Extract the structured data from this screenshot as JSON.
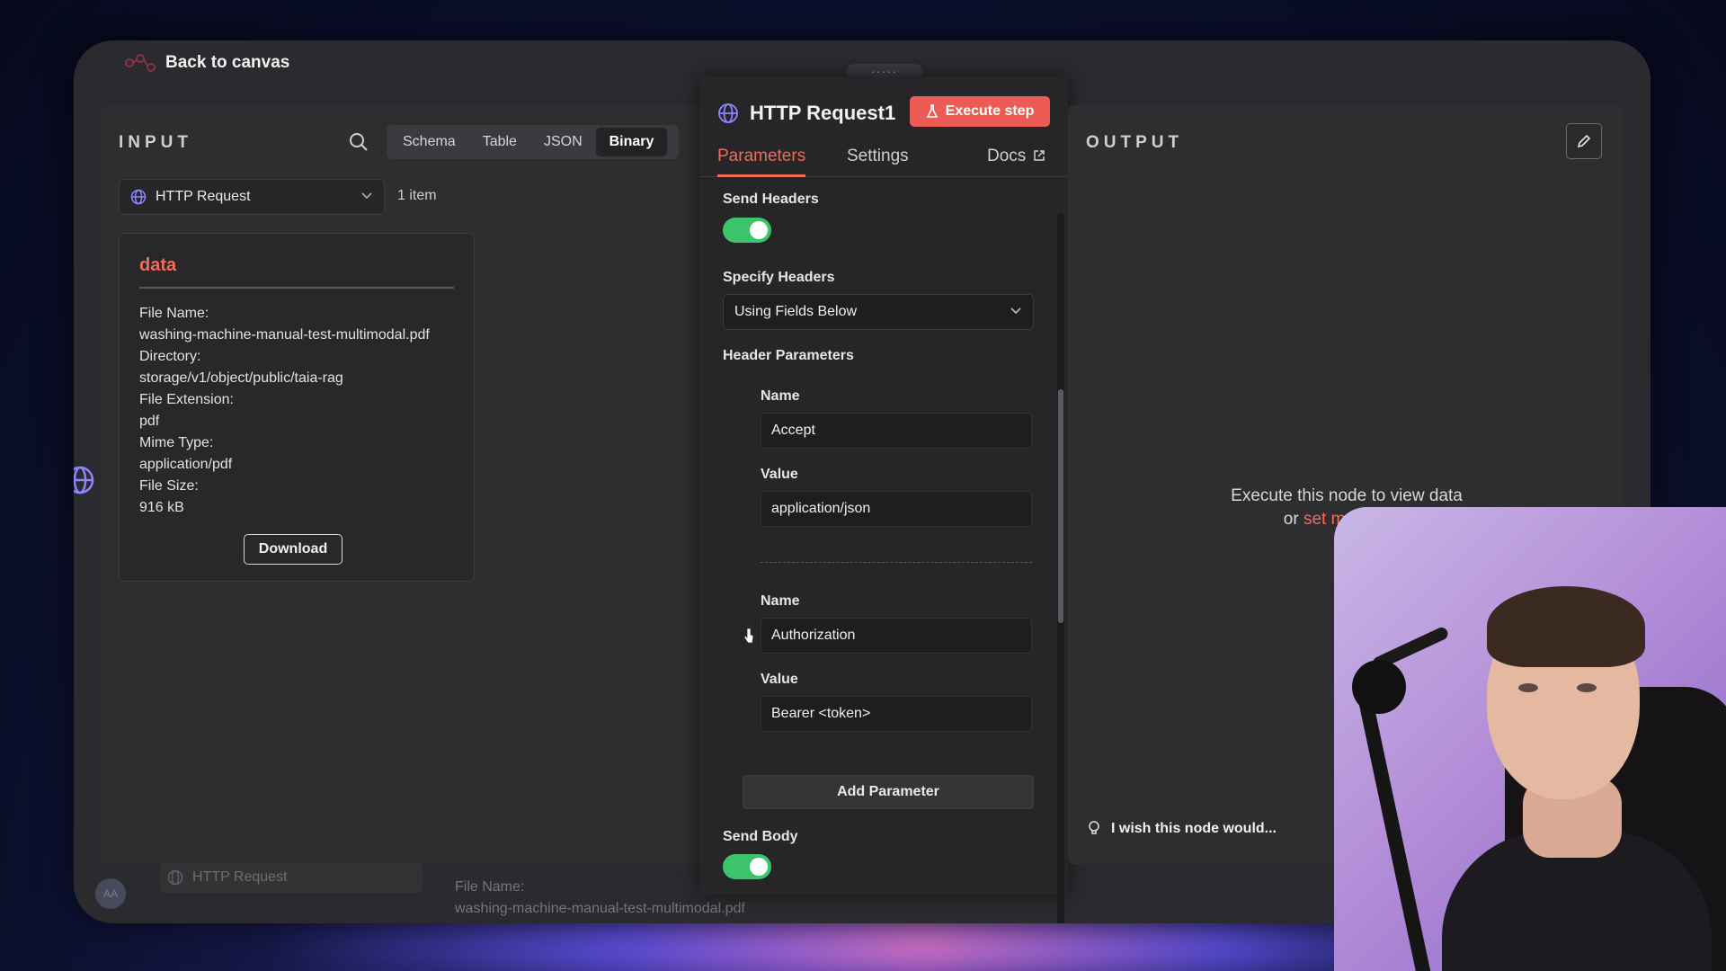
{
  "header": {
    "back_label": "Back to canvas",
    "drag_handle": ":::::"
  },
  "input": {
    "label": "INPUT",
    "view_tabs": [
      "Schema",
      "Table",
      "JSON",
      "Binary"
    ],
    "active_view": "Binary",
    "node_select": "HTTP Request",
    "item_count": "1 item",
    "data_card": {
      "title": "data",
      "file_name_label": "File Name:",
      "file_name": "washing-machine-manual-test-multimodal.pdf",
      "directory_label": "Directory:",
      "directory": "storage/v1/object/public/taia-rag",
      "extension_label": "File Extension:",
      "extension": "pdf",
      "mime_label": "Mime Type:",
      "mime": "application/pdf",
      "size_label": "File Size:",
      "size": "916 kB",
      "download_label": "Download"
    },
    "bottom_node": "HTTP Request",
    "bottom_file_label": "File Name:",
    "bottom_file_name": "washing-machine-manual-test-multimodal.pdf",
    "avatar_initials": "AA"
  },
  "params": {
    "title": "HTTP Request1",
    "execute_label": "Execute step",
    "tabs": [
      "Parameters",
      "Settings",
      "Docs"
    ],
    "active_tab": "Parameters",
    "send_headers_label": "Send Headers",
    "send_headers": true,
    "specify_headers_label": "Specify Headers",
    "specify_headers_value": "Using Fields Below",
    "header_params_label": "Header Parameters",
    "headers": [
      {
        "name_label": "Name",
        "name": "Accept",
        "value_label": "Value",
        "value": "application/json"
      },
      {
        "name_label": "Name",
        "name": "Authorization",
        "value_label": "Value",
        "value": "Bearer <token>"
      }
    ],
    "add_parameter_label": "Add Parameter",
    "send_body_label": "Send Body",
    "send_body": true
  },
  "output": {
    "label": "OUTPUT",
    "message_line1": "Execute this node to view data",
    "message_prefix": "or",
    "message_link": "set mock data",
    "wish_text": "I wish this node would..."
  },
  "colors": {
    "accent": "#ef6b5b",
    "toggle_on": "#3cc46a",
    "execute_bg": "#ec5c54"
  }
}
